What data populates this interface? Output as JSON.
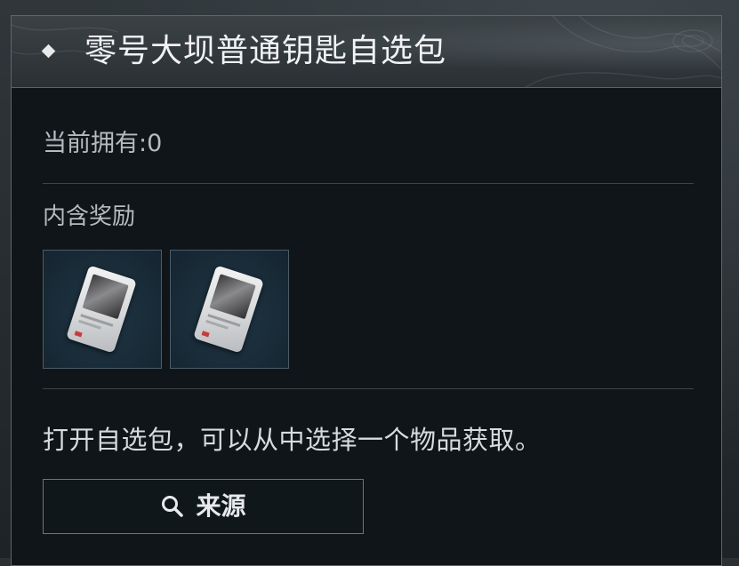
{
  "panel": {
    "title": "零号大坝普通钥匙自选包",
    "owned_text": "当前拥有:0",
    "contains_label": "内含奖励",
    "rewards": [
      {
        "icon": "keycard-icon"
      },
      {
        "icon": "keycard-icon"
      }
    ],
    "description": "打开自选包，可以从中选择一个物品获取。",
    "source_button": {
      "icon": "search-icon",
      "label": "来源"
    }
  },
  "colors": {
    "panel_background": "#0f1518",
    "header_background": "#353c40",
    "reward_slot_background": "#182a36",
    "text_primary": "#f0f2f3",
    "text_secondary": "#b5bbbf"
  }
}
